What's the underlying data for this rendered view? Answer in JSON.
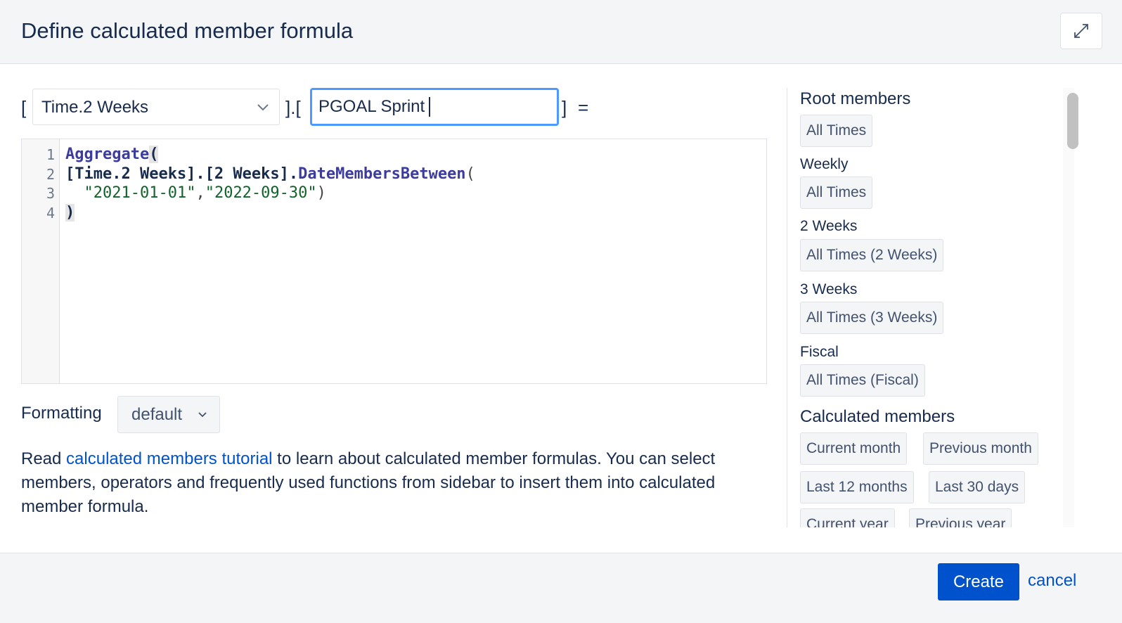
{
  "dialog": {
    "title": "Define calculated member formula",
    "expand_icon": "expand-diagonal-icon"
  },
  "definition": {
    "open_bracket": "[",
    "dimension_select": "Time.2 Weeks",
    "separator": "].[",
    "member_name": "PGOAL Sprint",
    "close_bracket": "]",
    "equals": "="
  },
  "editor": {
    "line_numbers": [
      "1",
      "2",
      "3",
      "4"
    ],
    "lines": {
      "l1_keyword": "Aggregate",
      "l1_paren": "(",
      "l2_member": "[Time.2 Weeks].[2 Weeks]",
      "l2_dot": ".",
      "l2_function": "DateMembersBetween",
      "l2_paren": "(",
      "l3_indent": "  ",
      "l3_str1": "\"2021-01-01\"",
      "l3_comma": ",",
      "l3_str2": "\"2022-09-30\"",
      "l3_paren": ")",
      "l4_paren": ")"
    }
  },
  "formatting": {
    "label": "Formatting",
    "value": "default"
  },
  "help": {
    "prefix": "Read ",
    "link": "calculated members tutorial",
    "suffix": " to learn about calculated member formulas. You can select members, operators and frequently used functions from sidebar to insert them into calculated member formula."
  },
  "sidebar": {
    "root_heading": "Root members",
    "root_chip": "All Times",
    "weekly_heading": "Weekly",
    "weekly_chip": "All Times",
    "two_weeks_heading": "2 Weeks",
    "two_weeks_chip": "All Times (2 Weeks)",
    "three_weeks_heading": "3 Weeks",
    "three_weeks_chip": "All Times (3 Weeks)",
    "fiscal_heading": "Fiscal",
    "fiscal_chip": "All Times (Fiscal)",
    "calc_heading": "Calculated members",
    "calc_chips": [
      "Current month",
      "Previous month",
      "Last 12 months",
      "Last 30 days",
      "Current year",
      "Previous year"
    ]
  },
  "footer": {
    "create_label": "Create",
    "cancel_label": "cancel"
  },
  "colors": {
    "primary": "#0052cc",
    "focus": "#4c9aff",
    "header_bg": "#f4f5f7"
  }
}
